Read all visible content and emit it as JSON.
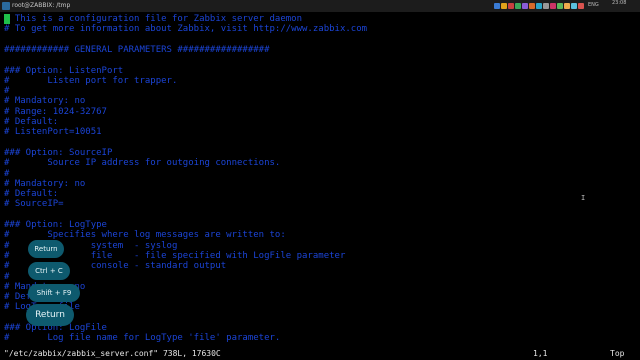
{
  "window": {
    "title": "root@ZABBIX: /tmp"
  },
  "taskbar": {
    "lang": "ENG",
    "time": "23:08",
    "date": "",
    "icons": [
      "#3a7bd5",
      "#e0a21b",
      "#c94040",
      "#3aa65a",
      "#8a5cd6",
      "#d66a2a",
      "#2aa6c9",
      "#999999",
      "#cc3366",
      "#5cb85c",
      "#f0ad4e",
      "#5bc0de",
      "#d9534f"
    ]
  },
  "terminal": {
    "lines": [
      "  This is a configuration file for Zabbix server daemon",
      "# To get more information about Zabbix, visit http://www.zabbix.com",
      "",
      "############ GENERAL PARAMETERS #################",
      "",
      "### Option: ListenPort",
      "#       Listen port for trapper.",
      "#",
      "# Mandatory: no",
      "# Range: 1024-32767",
      "# Default:",
      "# ListenPort=10051",
      "",
      "### Option: SourceIP",
      "#       Source IP address for outgoing connections.",
      "#",
      "# Mandatory: no",
      "# Default:",
      "# SourceIP=",
      "",
      "### Option: LogType",
      "#       Specifies where log messages are written to:",
      "#               system  - syslog",
      "#               file    - file specified with LogFile parameter",
      "#               console - standard output",
      "#",
      "# Mandatory: no",
      "# Default:",
      "# LogType=file",
      "",
      "### Option: LogFile",
      "#       Log file name for LogType 'file' parameter."
    ]
  },
  "keys": {
    "return_small": "Return",
    "ctrl_c": "Ctrl + C",
    "shift_f9": "Shift + F9",
    "return_big": "Return"
  },
  "status": {
    "file": "\"/etc/zabbix/zabbix_server.conf\" 738L, 17630C",
    "position": "1,1",
    "scroll": "Top"
  }
}
